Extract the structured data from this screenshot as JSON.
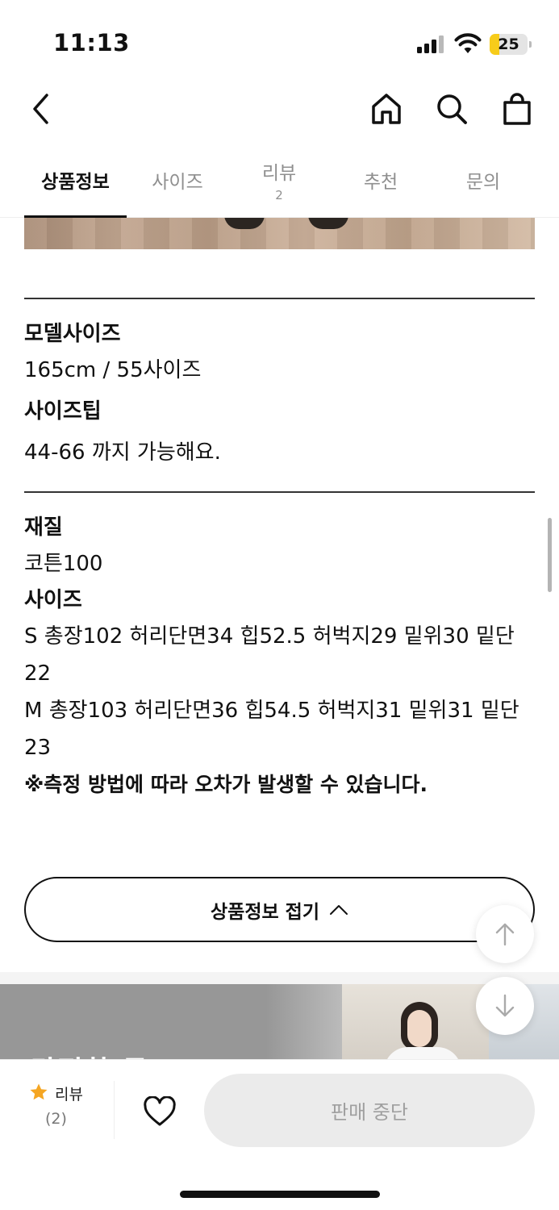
{
  "status_bar": {
    "time": "11:13",
    "battery": "25",
    "battery_level": 0.25
  },
  "nav": {
    "back_icon": "chevron-left-icon",
    "home_icon": "home-icon",
    "search_icon": "search-icon",
    "cart_icon": "shopping-bag-icon"
  },
  "tabs": [
    {
      "label": "상품정보",
      "active": true
    },
    {
      "label": "사이즈"
    },
    {
      "label": "리뷰",
      "count": "2"
    },
    {
      "label": "추천"
    },
    {
      "label": "문의"
    }
  ],
  "model_size": {
    "title": "모델사이즈",
    "value": "165cm / 55사이즈"
  },
  "size_tip": {
    "title": "사이즈팁",
    "value": "44-66 까지 가능해요."
  },
  "material": {
    "title": "재질",
    "value": "코튼100"
  },
  "sizes": {
    "title": "사이즈",
    "lines": [
      "S 총장102 허리단면34 힙52.5 허벅지29 밑위30 밑단22",
      "M 총장103 허리단면36 힙54.5 허벅지31 밑위31 밑단23"
    ],
    "note": "※측정 방법에 따라 오차가 발생할 수 있습니다."
  },
  "collapse_button": {
    "label": "상품정보 접기"
  },
  "floating": {
    "scroll_top_icon": "arrow-up-icon",
    "scroll_down_icon": "arrow-down-icon"
  },
  "banner": {
    "text": "단정한 무드"
  },
  "bottom_bar": {
    "review_label": "리뷰",
    "review_count": "(2)",
    "wish_icon": "heart-icon",
    "status_button": "판매 중단"
  },
  "colors": {
    "text": "#111111",
    "muted": "#8f8f8f",
    "battery_fill": "#f7cc1a",
    "star": "#f5a623",
    "disabled_bg": "#ebebeb"
  }
}
